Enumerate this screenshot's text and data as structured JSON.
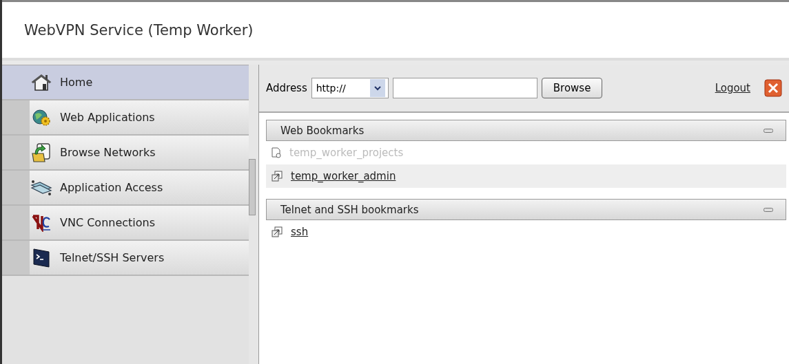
{
  "window": {
    "title": "WebVPN Service (Temp Worker)"
  },
  "sidebar": {
    "items": [
      {
        "label": "Home",
        "kind": "home",
        "selected": true
      },
      {
        "label": "Web Applications",
        "kind": "webapps",
        "selected": false
      },
      {
        "label": "Browse Networks",
        "kind": "browse",
        "selected": false
      },
      {
        "label": "Application Access",
        "kind": "appaccess",
        "selected": false
      },
      {
        "label": "VNC Connections",
        "kind": "vnc",
        "selected": false
      },
      {
        "label": "Telnet/SSH Servers",
        "kind": "terminal",
        "selected": false
      }
    ]
  },
  "toolbar": {
    "address_label": "Address",
    "protocol": "http://",
    "browse_button": "Browse",
    "logout": "Logout"
  },
  "sections": [
    {
      "title": "Web Bookmarks",
      "items": [
        {
          "label": "temp_worker_projects",
          "disabled": true,
          "selected": false
        },
        {
          "label": "temp_worker_admin",
          "disabled": false,
          "selected": true
        }
      ]
    },
    {
      "title": "Telnet and SSH bookmarks",
      "items": [
        {
          "label": "ssh",
          "disabled": false,
          "selected": false
        }
      ]
    }
  ]
}
